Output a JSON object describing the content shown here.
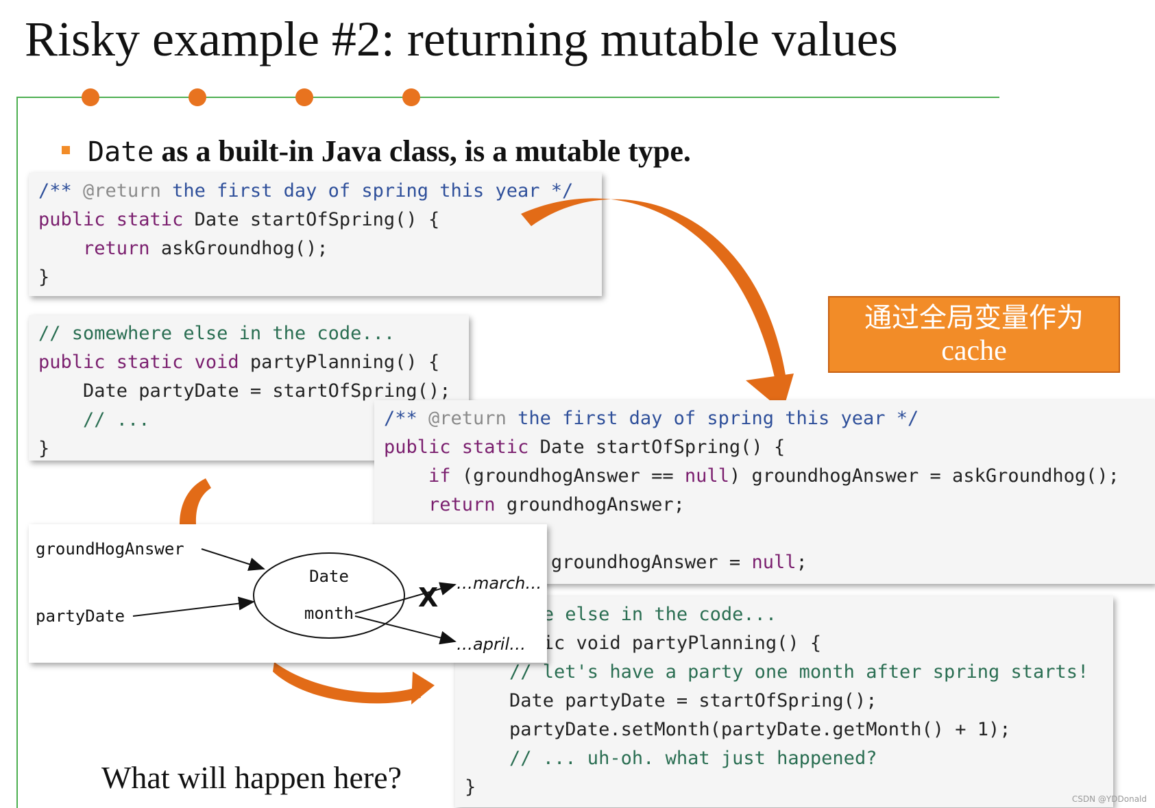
{
  "title": "Risky example #2: returning mutable values",
  "bullet": {
    "code_word": "Date",
    "text": " as a built-in Java class, is a mutable type."
  },
  "code_block_1": {
    "lines": [
      [
        {
          "t": "/** ",
          "c": "cm"
        },
        {
          "t": "@return",
          "c": "ann"
        },
        {
          "t": " the first day of spring this year */",
          "c": "cm"
        }
      ],
      [
        {
          "t": "public static ",
          "c": "kw"
        },
        {
          "t": "Date startOfSpring() {",
          "c": ""
        }
      ],
      [
        {
          "t": "    ",
          "c": ""
        },
        {
          "t": "return ",
          "c": "kw"
        },
        {
          "t": "askGroundhog();",
          "c": ""
        }
      ],
      [
        {
          "t": "}",
          "c": ""
        }
      ]
    ]
  },
  "code_block_2": {
    "lines": [
      [
        {
          "t": "// somewhere else in the code...",
          "c": "cm2"
        }
      ],
      [
        {
          "t": "public static void ",
          "c": "kw"
        },
        {
          "t": "partyPlanning() {",
          "c": ""
        }
      ],
      [
        {
          "t": "    Date partyDate = startOfSpring();",
          "c": ""
        }
      ],
      [
        {
          "t": "    // ...",
          "c": "cm2"
        }
      ],
      [
        {
          "t": "}",
          "c": ""
        }
      ]
    ]
  },
  "code_block_3": {
    "lines": [
      [
        {
          "t": "/** ",
          "c": "cm"
        },
        {
          "t": "@return",
          "c": "ann"
        },
        {
          "t": " the first day of spring this year */",
          "c": "cm"
        }
      ],
      [
        {
          "t": "public static ",
          "c": "kw"
        },
        {
          "t": "Date startOfSpring() {",
          "c": ""
        }
      ],
      [
        {
          "t": "    ",
          "c": ""
        },
        {
          "t": "if ",
          "c": "kw"
        },
        {
          "t": "(groundhogAnswer == ",
          "c": ""
        },
        {
          "t": "null",
          "c": "kw"
        },
        {
          "t": ") groundhogAnswer = askGroundhog();",
          "c": ""
        }
      ],
      [
        {
          "t": "    ",
          "c": ""
        },
        {
          "t": "return ",
          "c": "kw"
        },
        {
          "t": "groundhogAnswer;",
          "c": ""
        }
      ],
      [
        {
          "t": "",
          "c": ""
        }
      ],
      [
        {
          "t": "          Date groundhogAnswer = ",
          "c": ""
        },
        {
          "t": "null",
          "c": "kw"
        },
        {
          "t": ";",
          "c": ""
        }
      ]
    ]
  },
  "code_block_4": {
    "lines": [
      [
        {
          "t": "   where else in the code...",
          "c": "cm2"
        }
      ],
      [
        {
          "t": "   static void partyPlanning() {",
          "c": ""
        }
      ],
      [
        {
          "t": "    // let's have a party one month after spring starts!",
          "c": "cm2"
        }
      ],
      [
        {
          "t": "    Date partyDate = startOfSpring();",
          "c": ""
        }
      ],
      [
        {
          "t": "    partyDate.setMonth(partyDate.getMonth() + 1);",
          "c": ""
        }
      ],
      [
        {
          "t": "    // ... uh-oh. what just happened?",
          "c": "cm2"
        }
      ],
      [
        {
          "t": "}",
          "c": ""
        }
      ]
    ]
  },
  "diagram": {
    "ref1": "groundHogAnswer",
    "ref2": "partyDate",
    "object_type": "Date",
    "field": "month",
    "value_old": "…march…",
    "value_new": "…april…",
    "cross_mark": "X"
  },
  "cache_note": {
    "line1": "通过全局变量作为",
    "line2": "cache"
  },
  "question": "What will happen here?",
  "watermark": "CSDN @YDDonald",
  "colors": {
    "accent_orange": "#f28c28",
    "frame_green": "#4caf50",
    "keyword": "#7a1e6e",
    "comment": "#2e4f9a"
  }
}
